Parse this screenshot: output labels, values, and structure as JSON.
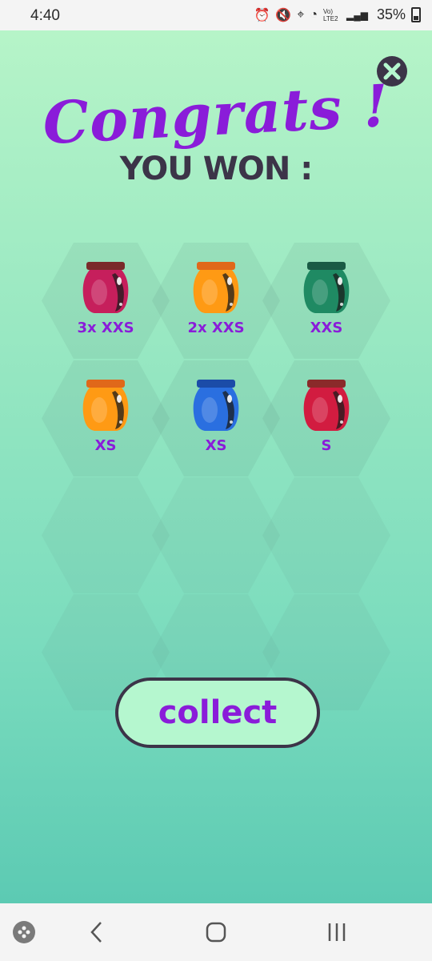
{
  "status_bar": {
    "time": "4:40",
    "icons": [
      "alarm-icon",
      "mute-icon",
      "location-icon",
      "wifi-icon",
      "volte-icon",
      "signal-icon",
      "battery-icon"
    ],
    "lte_label": "Vo) LTE2",
    "battery": "35%"
  },
  "popup": {
    "title": "Congrats !",
    "subtitle": "YOU WON :",
    "close_icon": "close-icon",
    "prizes": [
      {
        "label": "3x XXS",
        "jar_color": "#c61f5c",
        "lid_color": "#7a2a2a"
      },
      {
        "label": "2x XXS",
        "jar_color": "#ff9a14",
        "lid_color": "#e0681a"
      },
      {
        "label": "XXS",
        "jar_color": "#1f8a63",
        "lid_color": "#1a5a45"
      },
      {
        "label": "XS",
        "jar_color": "#ff9a14",
        "lid_color": "#e0681a"
      },
      {
        "label": "XS",
        "jar_color": "#2a6fe0",
        "lid_color": "#1b4ca8"
      },
      {
        "label": "S",
        "jar_color": "#d21c40",
        "lid_color": "#8a2a2a"
      }
    ],
    "collect_label": "collect"
  },
  "nav_bar": {
    "items": [
      "game-launcher-icon",
      "back-icon",
      "home-icon",
      "recents-icon"
    ]
  },
  "colors": {
    "accent": "#8a1cd9",
    "dark": "#3c3448",
    "button_fill": "#b5f7cf"
  }
}
